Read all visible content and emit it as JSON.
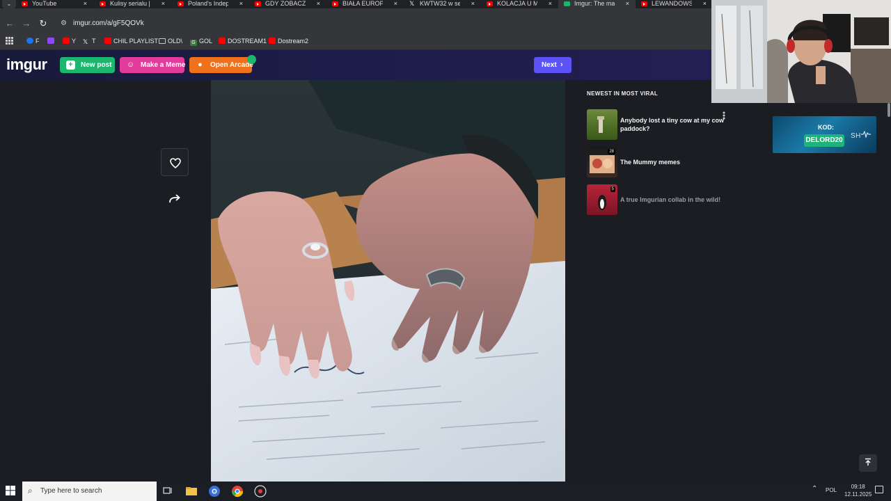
{
  "browser": {
    "tabs": [
      {
        "title": "YouTube",
        "icon": "youtube-icon",
        "active": false
      },
      {
        "title": "Kulisy serialu | He",
        "icon": "youtube-icon",
        "active": false
      },
      {
        "title": "Poland's Indepen",
        "icon": "youtube-icon",
        "active": false
      },
      {
        "title": "GDY ZOBACZYŁA",
        "icon": "youtube-icon",
        "active": false
      },
      {
        "title": "BIAŁA EUROPA I P",
        "icon": "youtube-icon",
        "active": false
      },
      {
        "title": "KWTW32 w serwi",
        "icon": "x-icon",
        "active": false
      },
      {
        "title": "KOLACJA U MAG",
        "icon": "youtube-icon",
        "active": false
      },
      {
        "title": "Imgur: The magic",
        "icon": "imgur-icon",
        "active": true
      },
      {
        "title": "LEWANDOWSKI E",
        "icon": "youtube-icon",
        "active": false
      }
    ],
    "tab_close": "×",
    "url": "imgur.com/a/gF5QOVk",
    "bookmarks": [
      {
        "label": "F",
        "icon": "facebook-icon"
      },
      {
        "label": "",
        "icon": "twitch-icon"
      },
      {
        "label": "Y",
        "icon": "youtube-icon"
      },
      {
        "label": "T",
        "icon": "x-icon"
      },
      {
        "label": "CHIL PLAYLIST",
        "icon": "youtube-icon"
      },
      {
        "label": "OLD\\",
        "icon": "folder-icon"
      },
      {
        "label": "GOL",
        "icon": "gol-icon"
      },
      {
        "label": "DOSTREAM1",
        "icon": "youtube-icon"
      },
      {
        "label": "Dostream2",
        "icon": "youtube-icon"
      }
    ]
  },
  "imgur": {
    "logo": "imgur",
    "new_post": "New post",
    "make_meme": "Make a Meme",
    "open_arcade": "Open Arcade",
    "next": "Next",
    "viral_heading": "NEWEST IN MOST VIRAL",
    "viral_items": [
      {
        "title": "Anybody lost a tiny cow at my cow paddock?",
        "count": ""
      },
      {
        "title": "The Mummy memes",
        "count": "28"
      },
      {
        "title": "A true Imgurian collab in the wild!",
        "count": "5"
      }
    ]
  },
  "ad": {
    "label": "KOD:",
    "code": "DELORD20",
    "brand": "SH"
  },
  "taskbar": {
    "search_placeholder": "Type here to search",
    "lang": "POL",
    "time": "09:18",
    "date": "12.11.2025"
  },
  "colors": {
    "imgur_green": "#1bb76e",
    "meme_pink": "#e23b9b",
    "arcade_orange": "#f0711c",
    "next_purple": "#5b53f5"
  }
}
